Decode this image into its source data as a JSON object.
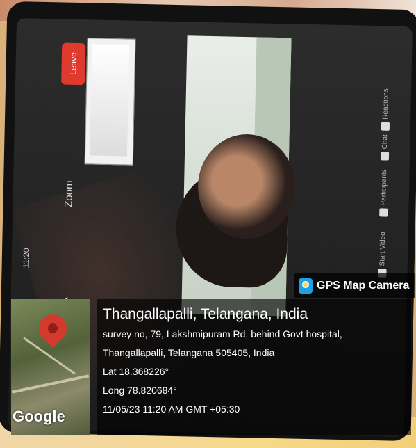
{
  "zoom_call": {
    "leave_label": "Leave",
    "app_label": "Zoom",
    "time_text": "11:20",
    "controls": [
      {
        "label": "Start Video",
        "icon": "video-off-icon"
      },
      {
        "label": "Participants",
        "icon": "participants-icon"
      },
      {
        "label": "Chat",
        "icon": "chat-icon"
      },
      {
        "label": "Reactions",
        "icon": "reactions-icon"
      }
    ]
  },
  "gps_stamp": {
    "app_name": "GPS Map Camera",
    "map_brand": "Google",
    "place_title": "Thangallapalli, Telangana, India",
    "address_line1": "survey no, 79, Lakshmipuram Rd, behind Govt hospital,",
    "address_line2": "Thangallapalli, Telangana 505405, India",
    "lat": "Lat 18.368226°",
    "long": "Long 78.820684°",
    "datetime": "11/05/23 11:20 AM GMT +05:30"
  }
}
